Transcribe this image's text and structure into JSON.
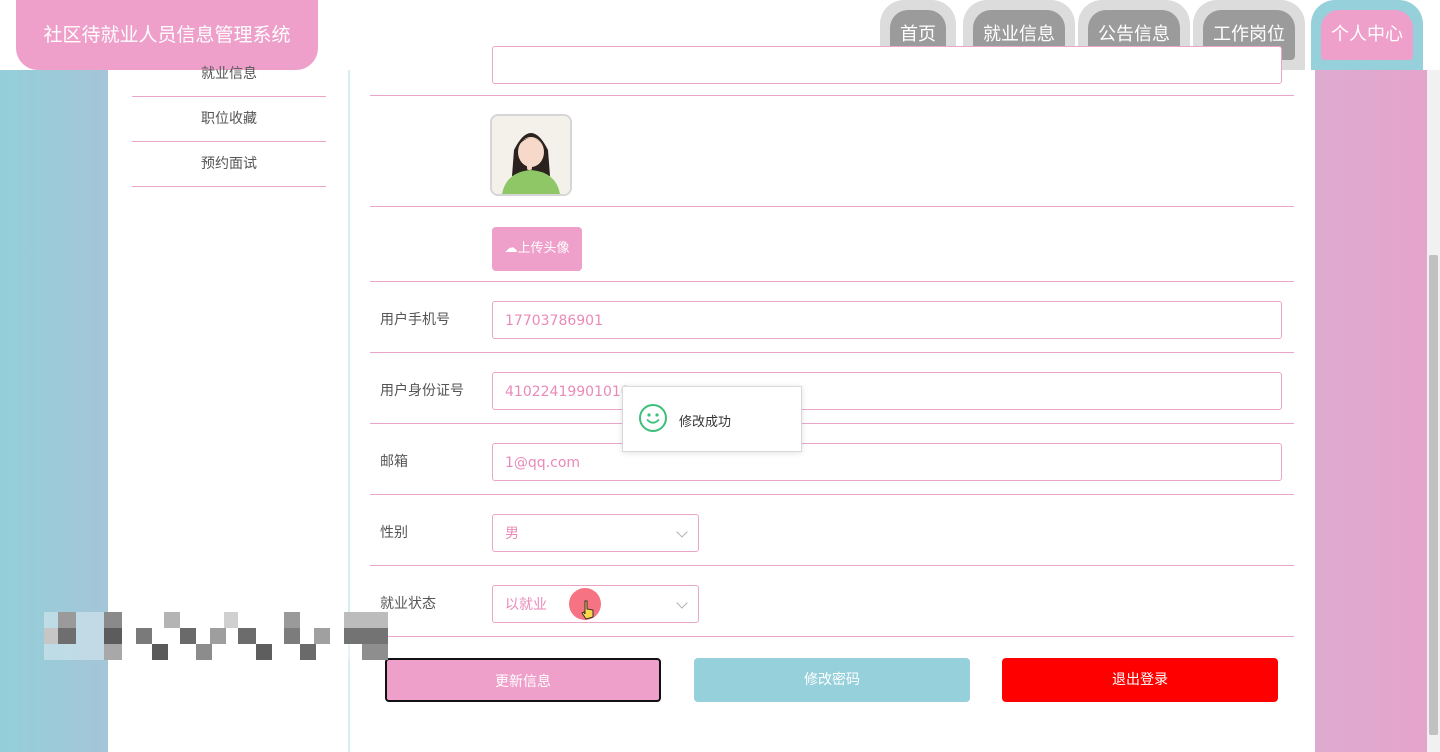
{
  "header": {
    "brand": "社区待就业人员信息管理系统",
    "nav": [
      {
        "label": "首页"
      },
      {
        "label": "就业信息"
      },
      {
        "label": "公告信息"
      },
      {
        "label": "工作岗位"
      },
      {
        "label": "个人中心",
        "active": true
      }
    ]
  },
  "sidebar": {
    "items": [
      {
        "label": "就业信息"
      },
      {
        "label": "职位收藏"
      },
      {
        "label": "预约面试"
      }
    ]
  },
  "form": {
    "upload_label": "上传头像",
    "phone": {
      "label": "用户手机号",
      "value": "17703786901"
    },
    "id_card": {
      "label": "用户身份证号",
      "value": "41022419901010"
    },
    "email": {
      "label": "邮箱",
      "value": "1@qq.com"
    },
    "gender": {
      "label": "性别",
      "value": "男"
    },
    "job_status": {
      "label": "就业状态",
      "value": "以就业"
    }
  },
  "buttons": {
    "update": "更新信息",
    "change_password": "修改密码",
    "logout": "退出登录"
  },
  "toast": {
    "message": "修改成功"
  },
  "colors": {
    "pink": "#ee9fca",
    "teal": "#96d0db",
    "red": "#ff0000",
    "gray_tab": "#9b9b9b"
  }
}
